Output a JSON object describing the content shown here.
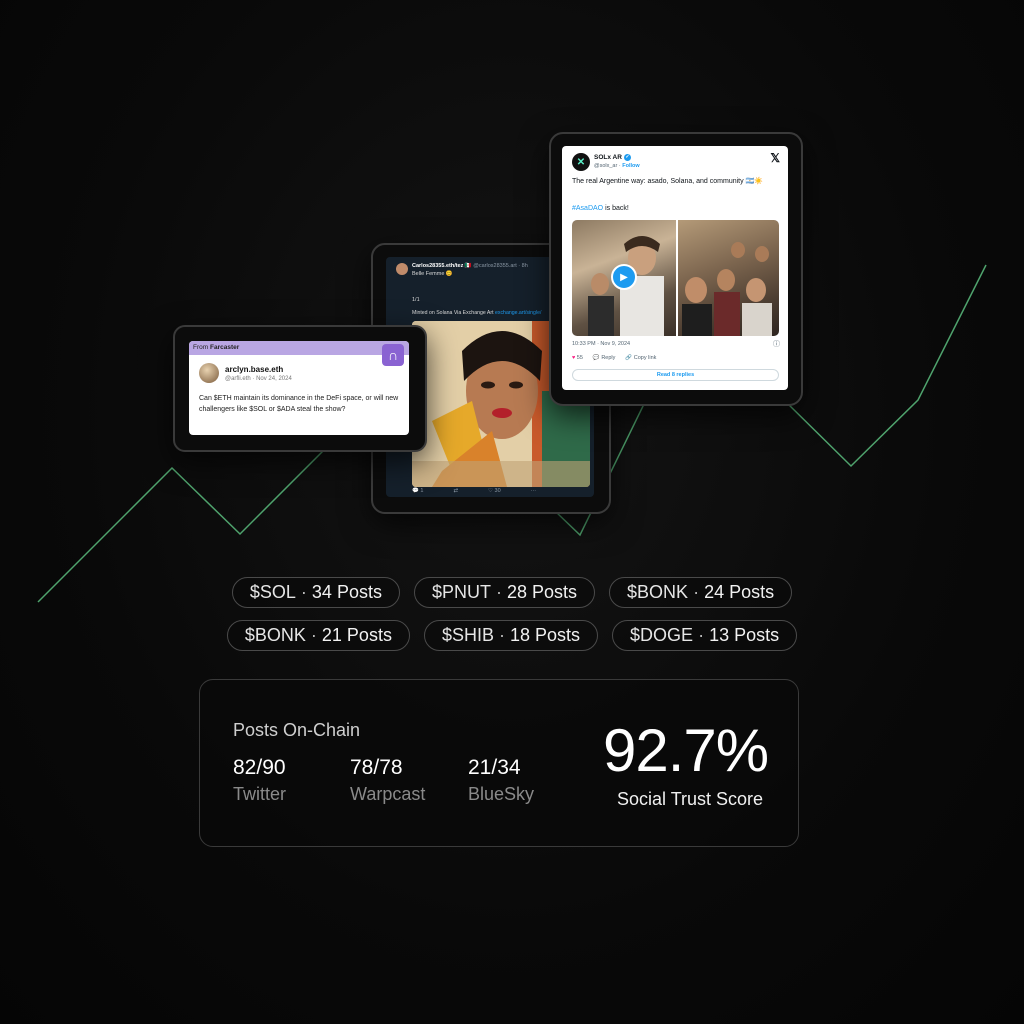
{
  "farcaster_card": {
    "source_prefix": "From",
    "source": "Farcaster",
    "logo_glyph": "∩",
    "author": "arclyn.base.eth",
    "meta": "@arfli.eth · Nov 24, 2024",
    "text": "Can $ETH maintain its dominance in the DeFi space, or will new challengers like $SOL or $ADA steal the show?"
  },
  "art_tweet": {
    "author": "Carlos28355.eth/tez 🇲🇽",
    "handle": "@carlos28355.art · 8h",
    "subtitle": "Belle Femme 😊",
    "thread_num": "1/1",
    "mint_text": "Minted on Solana Via Exchange Art",
    "mint_link": "exchange.art/single/",
    "actions": [
      "💬 1",
      "⇄",
      "♡ 30",
      "···"
    ]
  },
  "sol_tweet": {
    "author": "SOLx AR",
    "verified": "✓",
    "handle": "@solx_ar",
    "follow": "Follow",
    "text": "The real Argentine way: asado, Solana, and community 🇦🇷☀️",
    "hashtag": "#AsaDAO",
    "hashtag_suffix": " is back!",
    "timestamp": "10:33 PM · Nov 9, 2024",
    "likes": "55",
    "reply_label": "Reply",
    "copy_label": "Copy link",
    "read_replies": "Read 8 replies"
  },
  "tokens": [
    [
      {
        "symbol": "$SOL",
        "count": "34 Posts"
      },
      {
        "symbol": "$PNUT",
        "count": "28 Posts"
      },
      {
        "symbol": "$BONK",
        "count": "24 Posts"
      }
    ],
    [
      {
        "symbol": "$BONK",
        "count": "21 Posts"
      },
      {
        "symbol": "$SHIB",
        "count": "18 Posts"
      },
      {
        "symbol": "$DOGE",
        "count": "13 Posts"
      }
    ]
  ],
  "stats": {
    "title": "Posts On-Chain",
    "items": [
      {
        "value": "82/90",
        "label": "Twitter"
      },
      {
        "value": "78/78",
        "label": "Warpcast"
      },
      {
        "value": "21/34",
        "label": "BlueSky"
      }
    ],
    "score": "92.7%",
    "score_label": "Social Trust Score"
  },
  "colors": {
    "background": "#0a0a0a",
    "trend_line": "#4fa36d",
    "farcaster_purple": "#8a63d2",
    "twitter_blue": "#1d9bf0"
  }
}
